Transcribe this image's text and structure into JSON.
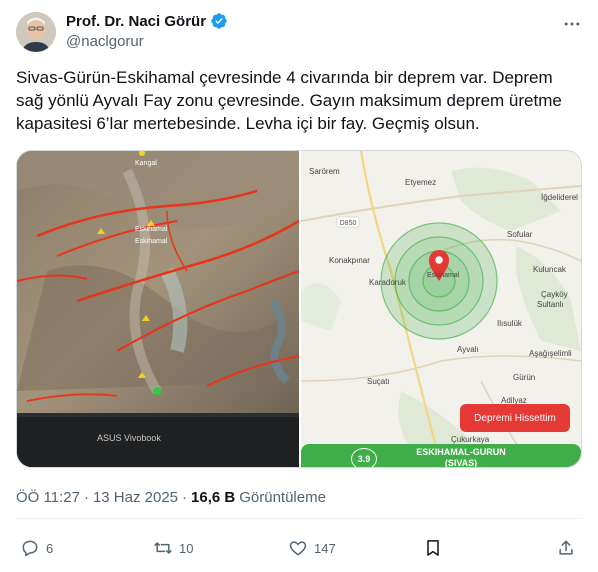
{
  "author": {
    "name": "Prof. Dr. Naci Görür",
    "handle": "@naclgorur"
  },
  "post": {
    "text": "Sivas-Gürün-Eskihamal çevresinde 4 civarında bir deprem var. Deprem sağ yönlü Ayvalı Fay zonu çevresinde. Gayın maksimum deprem üretme kapasitesi 6’lar mertebesinde. Levha içi bir fay. Geçmiş olsun.",
    "time": "ÖÖ 11:27",
    "separator": "·",
    "date": "13 Haz 2025",
    "views_count": "16,6 B",
    "views_label": "Görüntüleme"
  },
  "media_left": {
    "laptop_brand": "ASUS Vivobook",
    "map_labels": [
      "Kangal",
      "Eskihamal",
      "Eskihamal"
    ]
  },
  "media_right": {
    "places": [
      "Sarörem",
      "Etyemez",
      "İğdeliderel",
      "Sofular",
      "Konakpınar",
      "Eskihamal",
      "Kuluncak",
      "Karadoruk",
      "Çayköy",
      "Sultanlı",
      "Ilısulük",
      "Ayvalı",
      "Aşağışelimli",
      "Gürün",
      "Suçatı",
      "Adilyaz",
      "Çukurkaya"
    ],
    "road": "D850",
    "felt_button": "Depremi Hissettim",
    "magnitude": "3.9",
    "location_line1": "ESKIHAMAL-GURUN",
    "location_line2": "(SIVAS)"
  },
  "actions": {
    "replies": "6",
    "reposts": "10",
    "likes": "147"
  },
  "colors": {
    "verified": "#1d9bf0",
    "secondary_text": "#536471",
    "quake_green": "#3fae49",
    "felt_red": "#e53935",
    "map_bg": "#f3f1ec"
  }
}
